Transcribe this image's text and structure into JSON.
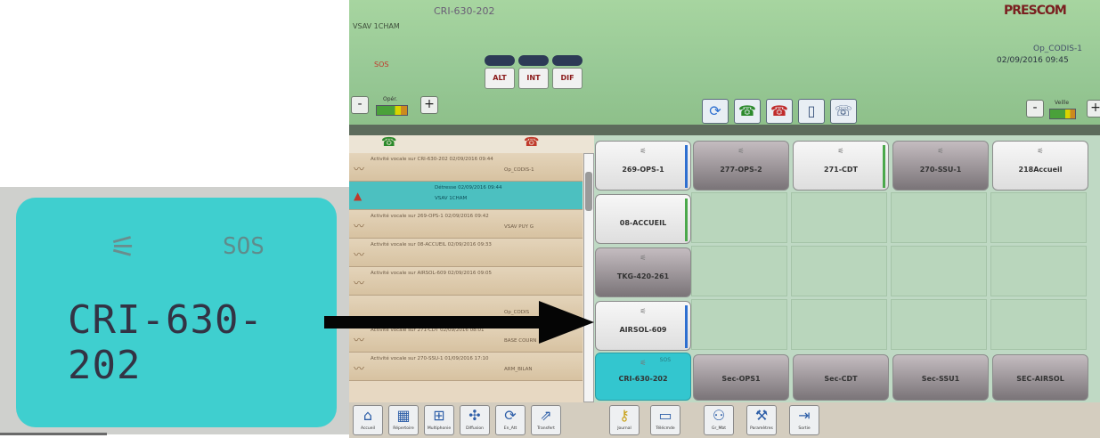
{
  "inset": {
    "sos": "SOS",
    "name": "CRI-630-202"
  },
  "header": {
    "title": "CRI-630-202",
    "user": "VSAV 1CHAM",
    "brand": "PRESCOM",
    "operator": "Op_CODIS-1",
    "datetime": "02/09/2016 09:45",
    "sos_label": "SOS",
    "buttons": [
      "ALT",
      "INT",
      "DIF"
    ],
    "opér_label": "Opér.",
    "veille_label": "Veille"
  },
  "events": [
    {
      "text": "Activité vocale sur CRI-630-202  02/09/2016 09:44",
      "sub": "Op_CODIS-1"
    },
    {
      "text": "Détresse   02/09/2016 09:44",
      "sub": "VSAV 1CHAM",
      "alert": true
    },
    {
      "text": "Activité vocale sur 269-OPS-1  02/09/2016 09:42",
      "sub": "VSAV PUY G"
    },
    {
      "text": "Activité vocale sur 08-ACCUEIL  02/09/2016 09:33",
      "sub": ""
    },
    {
      "text": "Activité vocale sur AIRSOL-609  02/09/2016 09:05",
      "sub": ""
    },
    {
      "text": "",
      "sub": "Op_CODIS"
    },
    {
      "text": "Activité vocale sur 271-CDT  02/09/2016 08:01",
      "sub": "BASE COURN"
    },
    {
      "text": "Activité vocale sur 270-SSU-1  01/09/2016 17:10",
      "sub": "ARM_BILAN"
    }
  ],
  "channels": {
    "row1": [
      "269-OPS-1",
      "277-OPS-2",
      "271-CDT",
      "270-SSU-1",
      "218Accueil"
    ],
    "row2": [
      "08-ACCUEIL"
    ],
    "row3": [
      "TKG-420-261"
    ],
    "row4": [
      "AIRSOL-609"
    ],
    "row5": [
      "CRI-630-202",
      "Sec-OPS1",
      "Sec-CDT",
      "Sec-SSU1",
      "SEC-AIRSOL"
    ],
    "sos": "SOS"
  },
  "toolbar": [
    "Accueil",
    "Répertoire",
    "Multiphonie",
    "Diffusion",
    "En_Att",
    "Transfert",
    "Journal",
    "Télécmde",
    "Gr_Mbt",
    "Paramètres",
    "Sortie"
  ],
  "colors": {
    "accent": "#33c6cf",
    "header": "#97c895",
    "events": "#e7d8c2"
  }
}
